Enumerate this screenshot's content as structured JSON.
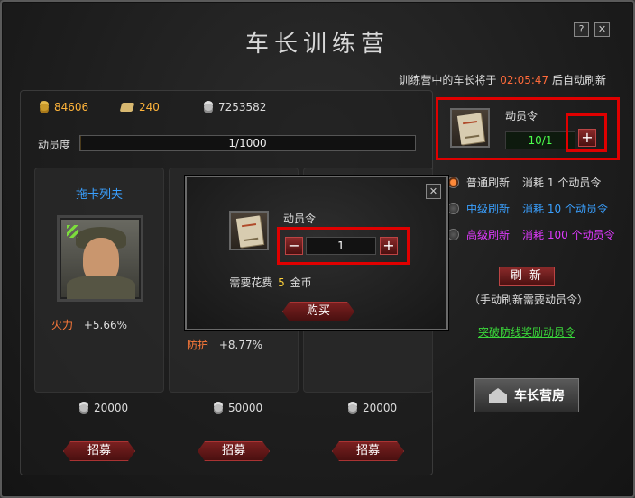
{
  "window": {
    "title": "车长训练营",
    "help_label": "?",
    "close_label": "✕"
  },
  "notice": {
    "prefix": "训练营中的车长将于",
    "time": "02:05:47",
    "suffix": "后自动刷新"
  },
  "resources": {
    "gold": "84606",
    "orders": "240",
    "silver": "7253582"
  },
  "morale": {
    "label": "动员度",
    "value": "1/1000",
    "fraction": 0.001
  },
  "cards": [
    {
      "name": "拖卡列夫",
      "stat_key": "火力",
      "stat_value": "+5.66%",
      "price": "20000",
      "recruit_label": "招募"
    },
    {
      "name": "",
      "stat_key": "防护",
      "stat_value": "+8.77%",
      "price": "50000",
      "recruit_label": "招募"
    },
    {
      "name": "",
      "stat_key": "",
      "stat_value": "",
      "price": "20000",
      "recruit_label": "招募"
    }
  ],
  "mobilization": {
    "item_name": "动员令",
    "count": "10/1",
    "plus_label": "+"
  },
  "refresh_options": [
    {
      "name": "普通刷新",
      "cost_prefix": "消耗",
      "cost_num": "1",
      "cost_suffix": "个动员令",
      "color": "#dddddd",
      "selected": true
    },
    {
      "name": "中级刷新",
      "cost_prefix": "消耗",
      "cost_num": "10",
      "cost_suffix": "个动员令",
      "color": "#3aa0ff",
      "selected": false
    },
    {
      "name": "高级刷新",
      "cost_prefix": "消耗",
      "cost_num": "100",
      "cost_suffix": "个动员令",
      "color": "#e03aff",
      "selected": false
    }
  ],
  "refresh": {
    "button_label": "刷 新",
    "note": "（手动刷新需要动员令）",
    "bonus_link": "突破防线奖励动员令"
  },
  "barracks": {
    "label": "车长营房"
  },
  "popup": {
    "title": "动员令",
    "quantity": "1",
    "minus_label": "−",
    "plus_label": "+",
    "cost_prefix": "需要花费",
    "cost_num": "5",
    "cost_suffix": "金币",
    "buy_label": "购买",
    "close_label": "✕"
  },
  "colors": {
    "accent_red": "#e00000",
    "gold": "#ffd23a",
    "count_green": "#4cff4c",
    "timer_orange": "#ff6a3a"
  }
}
